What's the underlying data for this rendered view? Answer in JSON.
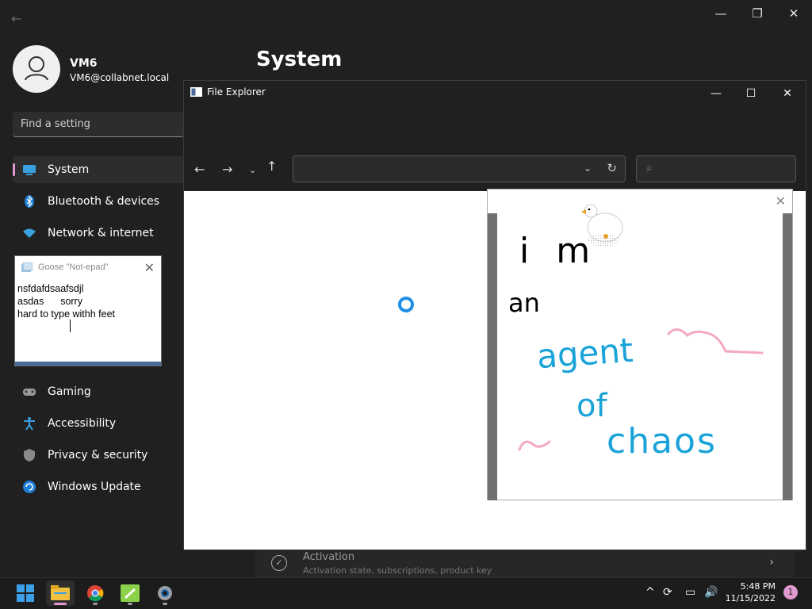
{
  "settings": {
    "page_title": "System",
    "user": {
      "name": "VM6",
      "email": "VM6@collabnet.local"
    },
    "search": {
      "placeholder": "Find a setting"
    },
    "nav": [
      {
        "label": "System",
        "icon": "monitor-icon"
      },
      {
        "label": "Bluetooth & devices",
        "icon": "bluetooth-icon"
      },
      {
        "label": "Network & internet",
        "icon": "wifi-icon"
      },
      {
        "label": "Gaming",
        "icon": "gamepad-icon"
      },
      {
        "label": "Accessibility",
        "icon": "accessibility-icon"
      },
      {
        "label": "Privacy & security",
        "icon": "shield-icon"
      },
      {
        "label": "Windows Update",
        "icon": "update-icon"
      }
    ],
    "activation": {
      "title": "Activation",
      "subtitle": "Activation state, subscriptions, product key"
    }
  },
  "notepad": {
    "title": "Goose \"Not-epad\"",
    "lines": [
      "nsfdafdsaafsdjl",
      "asdas      sorry",
      "hard to type withh feet"
    ]
  },
  "explorer": {
    "title": "File Explorer",
    "address": "",
    "search": ""
  },
  "drawing": {
    "lines": [
      "i m",
      "an",
      "agent",
      "of",
      "chaos"
    ]
  },
  "taskbar": {
    "time": "5:48 PM",
    "date": "11/15/2022",
    "notification_count": "1",
    "apps": [
      "start-icon",
      "file-explorer-icon",
      "chrome-icon",
      "notepad-icon",
      "settings-icon"
    ]
  },
  "colors": {
    "accent": "#e09ad0",
    "spinner": "#1f8fe8",
    "blue_ink": "#1aa3d8",
    "pink_ink": "#f3a8c4"
  }
}
